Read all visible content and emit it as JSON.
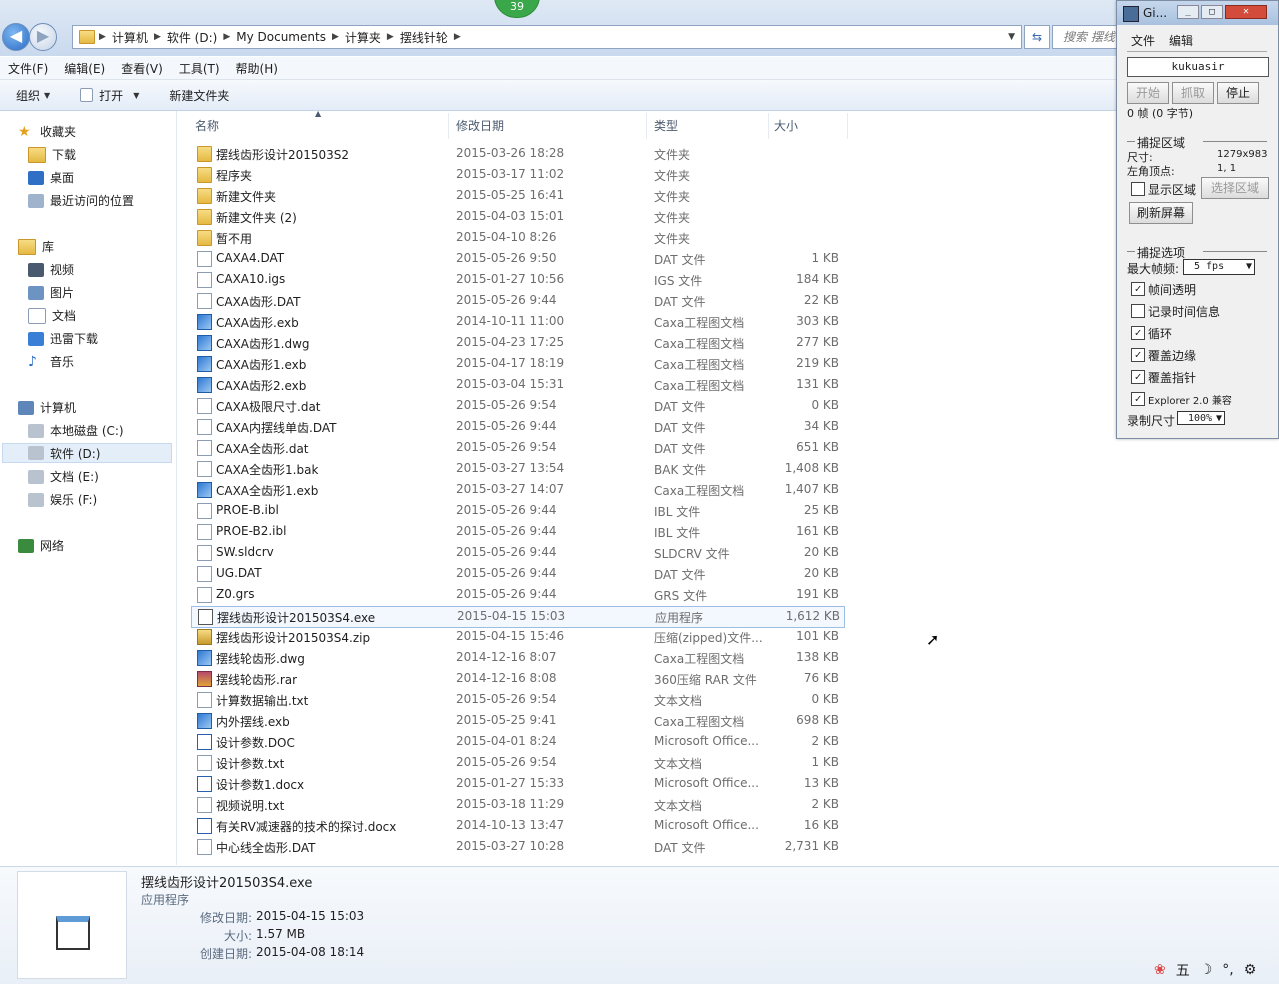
{
  "title_badge": "39",
  "address": {
    "crumbs": [
      "计算机",
      "软件 (D:)",
      "My Documents",
      "计算夹",
      "摆线针轮"
    ],
    "search_placeholder": "搜索 摆线"
  },
  "menu": [
    "文件(F)",
    "编辑(E)",
    "查看(V)",
    "工具(T)",
    "帮助(H)"
  ],
  "toolbar": {
    "organize": "组织",
    "open": "打开",
    "new_folder": "新建文件夹"
  },
  "nav": {
    "favorites": "收藏夹",
    "downloads": "下载",
    "desktop": "桌面",
    "recent": "最近访问的位置",
    "libraries": "库",
    "videos": "视频",
    "pictures": "图片",
    "documents": "文档",
    "xunlei": "迅雷下载",
    "music": "音乐",
    "computer": "计算机",
    "drive_c": "本地磁盘 (C:)",
    "drive_d": "软件 (D:)",
    "drive_e": "文档 (E:)",
    "drive_f": "娱乐 (F:)",
    "network": "网络"
  },
  "columns": {
    "name": "名称",
    "date": "修改日期",
    "type": "类型",
    "size": "大小"
  },
  "files": [
    {
      "name": "摆线齿形设计201503S2",
      "date": "2015-03-26 18:28",
      "type": "文件夹",
      "size": "",
      "icon": "folder"
    },
    {
      "name": "程序夹",
      "date": "2015-03-17 11:02",
      "type": "文件夹",
      "size": "",
      "icon": "folder"
    },
    {
      "name": "新建文件夹",
      "date": "2015-05-25 16:41",
      "type": "文件夹",
      "size": "",
      "icon": "folder"
    },
    {
      "name": "新建文件夹 (2)",
      "date": "2015-04-03 15:01",
      "type": "文件夹",
      "size": "",
      "icon": "folder"
    },
    {
      "name": "暂不用",
      "date": "2015-04-10 8:26",
      "type": "文件夹",
      "size": "",
      "icon": "folder"
    },
    {
      "name": "CAXA4.DAT",
      "date": "2015-05-26 9:50",
      "type": "DAT 文件",
      "size": "1 KB",
      "icon": "doc"
    },
    {
      "name": "CAXA10.igs",
      "date": "2015-01-27 10:56",
      "type": "IGS 文件",
      "size": "184 KB",
      "icon": "doc"
    },
    {
      "name": "CAXA齿形.DAT",
      "date": "2015-05-26 9:44",
      "type": "DAT 文件",
      "size": "22 KB",
      "icon": "doc"
    },
    {
      "name": "CAXA齿形.exb",
      "date": "2014-10-11 11:00",
      "type": "Caxa工程图文档",
      "size": "303 KB",
      "icon": "caxa"
    },
    {
      "name": "CAXA齿形1.dwg",
      "date": "2015-04-23 17:25",
      "type": "Caxa工程图文档",
      "size": "277 KB",
      "icon": "caxa"
    },
    {
      "name": "CAXA齿形1.exb",
      "date": "2015-04-17 18:19",
      "type": "Caxa工程图文档",
      "size": "219 KB",
      "icon": "caxa"
    },
    {
      "name": "CAXA齿形2.exb",
      "date": "2015-03-04 15:31",
      "type": "Caxa工程图文档",
      "size": "131 KB",
      "icon": "caxa"
    },
    {
      "name": "CAXA极限尺寸.dat",
      "date": "2015-05-26 9:54",
      "type": "DAT 文件",
      "size": "0 KB",
      "icon": "doc"
    },
    {
      "name": "CAXA内摆线单齿.DAT",
      "date": "2015-05-26 9:44",
      "type": "DAT 文件",
      "size": "34 KB",
      "icon": "doc"
    },
    {
      "name": "CAXA全齿形.dat",
      "date": "2015-05-26 9:54",
      "type": "DAT 文件",
      "size": "651 KB",
      "icon": "doc"
    },
    {
      "name": "CAXA全齿形1.bak",
      "date": "2015-03-27 13:54",
      "type": "BAK 文件",
      "size": "1,408 KB",
      "icon": "doc"
    },
    {
      "name": "CAXA全齿形1.exb",
      "date": "2015-03-27 14:07",
      "type": "Caxa工程图文档",
      "size": "1,407 KB",
      "icon": "caxa"
    },
    {
      "name": "PROE-B.ibl",
      "date": "2015-05-26 9:44",
      "type": "IBL 文件",
      "size": "25 KB",
      "icon": "doc"
    },
    {
      "name": "PROE-B2.ibl",
      "date": "2015-05-26 9:44",
      "type": "IBL 文件",
      "size": "161 KB",
      "icon": "doc"
    },
    {
      "name": "SW.sldcrv",
      "date": "2015-05-26 9:44",
      "type": "SLDCRV 文件",
      "size": "20 KB",
      "icon": "doc"
    },
    {
      "name": "UG.DAT",
      "date": "2015-05-26 9:44",
      "type": "DAT 文件",
      "size": "20 KB",
      "icon": "doc"
    },
    {
      "name": "Z0.grs",
      "date": "2015-05-26 9:44",
      "type": "GRS 文件",
      "size": "191 KB",
      "icon": "doc"
    },
    {
      "name": "摆线齿形设计201503S4.exe",
      "date": "2015-04-15 15:03",
      "type": "应用程序",
      "size": "1,612 KB",
      "icon": "exe"
    },
    {
      "name": "摆线齿形设计201503S4.zip",
      "date": "2015-04-15 15:46",
      "type": "压缩(zipped)文件...",
      "size": "101 KB",
      "icon": "zip"
    },
    {
      "name": "摆线轮齿形.dwg",
      "date": "2014-12-16 8:07",
      "type": "Caxa工程图文档",
      "size": "138 KB",
      "icon": "caxa"
    },
    {
      "name": "摆线轮齿形.rar",
      "date": "2014-12-16 8:08",
      "type": "360压缩 RAR 文件",
      "size": "76 KB",
      "icon": "rar"
    },
    {
      "name": "计算数据输出.txt",
      "date": "2015-05-26 9:54",
      "type": "文本文档",
      "size": "0 KB",
      "icon": "doc"
    },
    {
      "name": "内外摆线.exb",
      "date": "2015-05-25 9:41",
      "type": "Caxa工程图文档",
      "size": "698 KB",
      "icon": "caxa"
    },
    {
      "name": "设计参数.DOC",
      "date": "2015-04-01 8:24",
      "type": "Microsoft Office...",
      "size": "2 KB",
      "icon": "word"
    },
    {
      "name": "设计参数.txt",
      "date": "2015-05-26 9:54",
      "type": "文本文档",
      "size": "1 KB",
      "icon": "doc"
    },
    {
      "name": "设计参数1.docx",
      "date": "2015-01-27 15:33",
      "type": "Microsoft Office...",
      "size": "13 KB",
      "icon": "word"
    },
    {
      "name": "视频说明.txt",
      "date": "2015-03-18 11:29",
      "type": "文本文档",
      "size": "2 KB",
      "icon": "doc"
    },
    {
      "name": "有关RV减速器的技术的探讨.docx",
      "date": "2014-10-13 13:47",
      "type": "Microsoft Office...",
      "size": "16 KB",
      "icon": "word"
    },
    {
      "name": "中心线全齿形.DAT",
      "date": "2015-03-27 10:28",
      "type": "DAT 文件",
      "size": "2,731 KB",
      "icon": "doc"
    }
  ],
  "selected_index": 22,
  "details": {
    "name": "摆线齿形设计201503S4.exe",
    "kind": "应用程序",
    "modified_label": "修改日期:",
    "modified": "2015-04-15 15:03",
    "size_label": "大小:",
    "size": "1.57 MB",
    "created_label": "创建日期:",
    "created": "2015-04-08 18:14"
  },
  "recorder": {
    "title": "Gi...",
    "menu": [
      "文件",
      "编辑"
    ],
    "user": "kukuasir",
    "btn_start": "开始",
    "btn_capture": "抓取",
    "btn_stop": "停止",
    "frames": "0 帧 (0 字节)",
    "region_header": "捕捉区域",
    "size_label": "尺寸:",
    "size_value": "1279x983",
    "corner_label": "左角顶点:",
    "corner_value": "1, 1",
    "show_region": "显示区域",
    "select_region": "选择区域",
    "refresh_screen": "刷新屏幕",
    "options_header": "捕捉选项",
    "max_fps_label": "最大帧频:",
    "max_fps_value": "5 fps",
    "opt_transparent": "帧间透明",
    "opt_time": "记录时间信息",
    "opt_loop": "循环",
    "opt_border": "覆盖边缘",
    "opt_pointer": "覆盖指针",
    "opt_explorer": "Explorer 2.0 兼容",
    "rec_size_label": "录制尺寸",
    "rec_size_value": "100%"
  },
  "tray": [
    "五"
  ]
}
